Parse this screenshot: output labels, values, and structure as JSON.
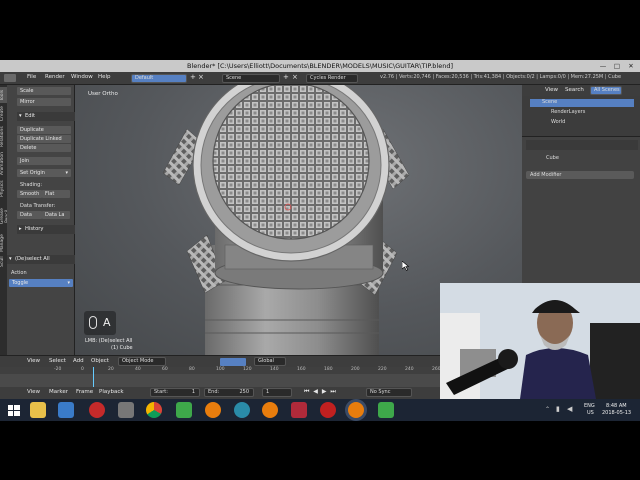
{
  "window": {
    "title": "Blender* [C:\\Users\\Elliott\\Documents\\BLENDER\\MODELS\\MUSIC\\GUITAR\\TIP.blend]",
    "minimize_glyph": "—",
    "maximize_glyph": "□",
    "close_glyph": "✕"
  },
  "info_header": {
    "menus": [
      "File",
      "Render",
      "Window",
      "Help"
    ],
    "layout": "Default",
    "scene": "Scene",
    "engine": "Cycles Render",
    "stats": "v2.76 | Verts:20,746 | Faces:20,536 | Tris:41,384 | Objects:0/2 | Lamps:0/0 | Mem:27.25M | Cube"
  },
  "tool_tabs": [
    "Tools",
    "Create",
    "Relations",
    "Animation",
    "Physics",
    "Grease Pencil",
    "Manage",
    "Scull"
  ],
  "toolshelf": {
    "top_buttons": [
      "Scale",
      "Mirror"
    ],
    "edit_header": "Edit",
    "edit_buttons": [
      "Duplicate",
      "Duplicate Linked",
      "Delete",
      "Join"
    ],
    "set_origin": "Set Origin",
    "shading_label": "Shading:",
    "smooth": "Smooth",
    "flat": "Flat",
    "data_transfer_label": "Data Transfer:",
    "data": "Data",
    "data_layout": "Data La",
    "history_header": "History"
  },
  "operator_panel": {
    "header": "(De)select All",
    "action_label": "Action",
    "action_value": "Toggle"
  },
  "viewport": {
    "view_label": "User Ortho",
    "key_hint": "A",
    "status_line1": "LMB: (De)select All",
    "status_line2": "(1) Cube"
  },
  "viewport_header": {
    "menus": [
      "View",
      "Select",
      "Add",
      "Object"
    ],
    "mode": "Object Mode",
    "orientation": "Global"
  },
  "timeline": {
    "ticks": [
      "-20",
      "0",
      "20",
      "40",
      "60",
      "80",
      "100",
      "120",
      "140",
      "160",
      "180",
      "200",
      "220",
      "240",
      "260"
    ],
    "menus": [
      "View",
      "Marker",
      "Frame",
      "Playback"
    ],
    "start_label": "Start:",
    "start_value": "1",
    "end_label": "End:",
    "end_value": "250",
    "current_frame": "1",
    "sync": "No Sync"
  },
  "outliner": {
    "menus": [
      "View",
      "Search",
      "All Scenes"
    ],
    "items": [
      "Scene",
      "RenderLayers",
      "World"
    ]
  },
  "properties": {
    "object": "Cube",
    "add_modifier": "Add Modifier"
  },
  "taskbar": {
    "language": "ENG",
    "region": "US",
    "time": "8:48 AM",
    "date": "2018-05-13",
    "pinned_apps": [
      "start-icon",
      "file-explorer-icon",
      "media-player-icon",
      "adobe-reader-icon",
      "game-controller-icon",
      "chrome-icon",
      "camtasia-icon",
      "blender-icon",
      "globe-icon",
      "blender-icon",
      "origami-icon",
      "power-icon",
      "blender-active-icon",
      "camtasia-recorder-icon"
    ]
  },
  "colors": {
    "accent_blue": "#5680c2",
    "header_gray": "#3d3d3d",
    "panel_gray": "#444444",
    "taskbar": "#1c2534"
  }
}
